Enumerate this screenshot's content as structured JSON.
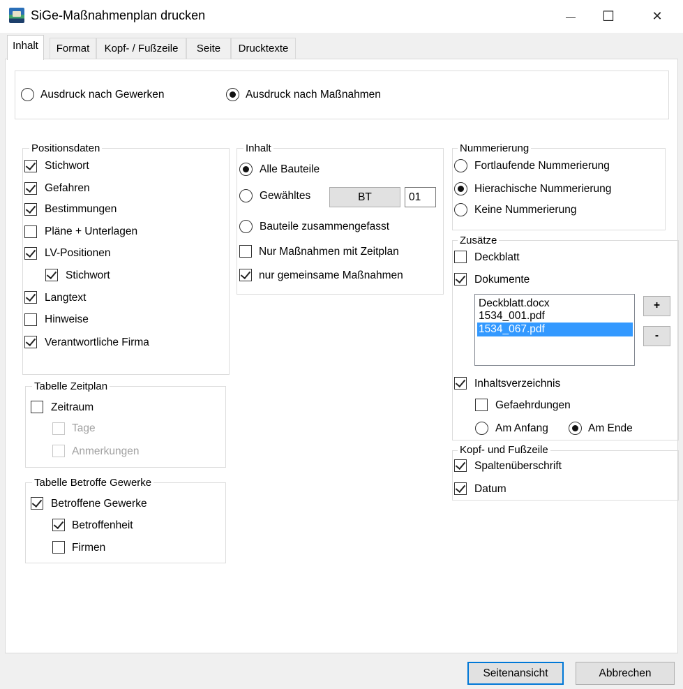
{
  "window": {
    "title": "SiGe-Maßnahmenplan drucken",
    "minimize_glyph": "—",
    "maximize_glyph": "☐",
    "close_glyph": "✕"
  },
  "tabs": [
    {
      "label": "Inhalt",
      "active": true
    },
    {
      "label": "Format",
      "active": false
    },
    {
      "label": "Kopf- / Fußzeile",
      "active": false
    },
    {
      "label": "Seite",
      "active": false
    },
    {
      "label": "Drucktexte",
      "active": false
    }
  ],
  "print_mode": {
    "options": [
      {
        "label": "Ausdruck nach Gewerken",
        "checked": false
      },
      {
        "label": "Ausdruck nach Maßnahmen",
        "checked": true
      }
    ]
  },
  "positionsdaten": {
    "title": "Positionsdaten",
    "items": [
      {
        "label": "Stichwort",
        "checked": true
      },
      {
        "label": "Gefahren",
        "checked": true
      },
      {
        "label": "Bestimmungen",
        "checked": true
      },
      {
        "label": "Pläne + Unterlagen",
        "checked": false
      },
      {
        "label": "LV-Positionen",
        "checked": true
      },
      {
        "label": "Stichwort",
        "checked": true
      },
      {
        "label": "Langtext",
        "checked": true
      },
      {
        "label": "Hinweise",
        "checked": false
      },
      {
        "label": "Verantwortliche Firma",
        "checked": true
      }
    ]
  },
  "zeitplan": {
    "title": "Tabelle Zeitplan",
    "items": [
      {
        "label": "Zeitraum",
        "checked": false,
        "enabled": true
      },
      {
        "label": "Tage",
        "checked": false,
        "enabled": false
      },
      {
        "label": "Anmerkungen",
        "checked": false,
        "enabled": false
      }
    ]
  },
  "gewerke": {
    "title": "Tabelle Betroffe Gewerke",
    "items": [
      {
        "label": "Betroffene Gewerke",
        "checked": true
      },
      {
        "label": "Betroffenheit",
        "checked": true
      },
      {
        "label": "Firmen",
        "checked": false
      }
    ]
  },
  "inhalt": {
    "title": "Inhalt",
    "radios": [
      {
        "label": "Alle Bauteile",
        "checked": true
      },
      {
        "label": "Gewähltes",
        "checked": false
      },
      {
        "label": "Bauteile zusammengefasst",
        "checked": false
      }
    ],
    "bt_button": "BT",
    "bt_value": "01",
    "checks": [
      {
        "label": "Nur Maßnahmen mit Zeitplan",
        "checked": false
      },
      {
        "label": "nur gemeinsame Maßnahmen",
        "checked": true
      }
    ]
  },
  "nummerierung": {
    "title": "Nummerierung",
    "radios": [
      {
        "label": "Fortlaufende Nummerierung",
        "checked": false
      },
      {
        "label": "Hierachische Nummerierung",
        "checked": true
      },
      {
        "label": "Keine Nummerierung",
        "checked": false
      }
    ]
  },
  "zusaetze": {
    "title": "Zusätze",
    "deckblatt": {
      "label": "Deckblatt",
      "checked": false
    },
    "dokumente": {
      "label": "Dokumente",
      "checked": true
    },
    "documents": [
      {
        "name": "Deckblatt.docx",
        "selected": false
      },
      {
        "name": "1534_001.pdf",
        "selected": false
      },
      {
        "name": "1534_067.pdf",
        "selected": true
      }
    ],
    "add_label": "+",
    "remove_label": "-",
    "inhaltsverzeichnis": {
      "label": "Inhaltsverzeichnis",
      "checked": true
    },
    "gefaehrdungen": {
      "label": "Gefaehrdungen",
      "checked": false
    },
    "position": [
      {
        "label": "Am Anfang",
        "checked": false
      },
      {
        "label": "Am Ende",
        "checked": true
      }
    ]
  },
  "kopf_fusszeile": {
    "title": "Kopf- und Fußzeile",
    "items": [
      {
        "label": "Spaltenüberschrift",
        "checked": true
      },
      {
        "label": "Datum",
        "checked": true
      }
    ]
  },
  "footer": {
    "preview_label": "Seitenansicht",
    "cancel_label": "Abbrechen"
  }
}
